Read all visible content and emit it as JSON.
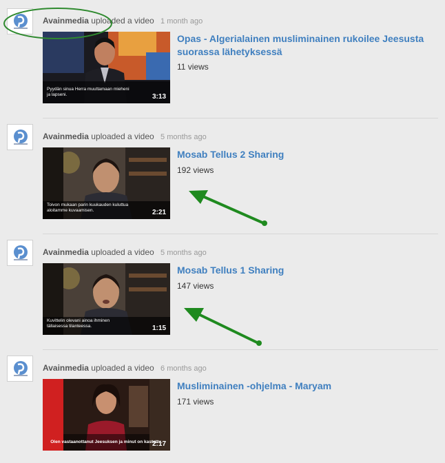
{
  "feed": {
    "items": [
      {
        "user": "Avainmedia",
        "action": "uploaded a video",
        "time": "1 month ago",
        "title": "Opas - Algerialainen musliminainen rukoilee Jeesusta suorassa lähetyksessä",
        "views": "11 views",
        "duration": "3:13",
        "subtitle": "Pyydän sinua Herra muuttamaan mieheni ja lapseni."
      },
      {
        "user": "Avainmedia",
        "action": "uploaded a video",
        "time": "5 months ago",
        "title": "Mosab Tellus 2 Sharing",
        "views": "192 views",
        "duration": "2:21",
        "subtitle": "Toivon mukaan parin kuukauden kuluttua aloitamme kuvaamisen."
      },
      {
        "user": "Avainmedia",
        "action": "uploaded a video",
        "time": "5 months ago",
        "title": "Mosab Tellus 1 Sharing",
        "views": "147 views",
        "duration": "1:15",
        "subtitle": "Kuvittelin olevani ainoa ihminen tällaisessa tilanteessa."
      },
      {
        "user": "Avainmedia",
        "action": "uploaded a video",
        "time": "6 months ago",
        "title": "Musliminainen -ohjelma - Maryam",
        "views": "171 views",
        "duration": "2:17",
        "subtitle": "Olen vastaanottanut Jeesuksen ja minut on kastettu."
      }
    ]
  },
  "annotations": {
    "highlight_color": "#2f8a2f",
    "arrow_color": "#1f8a1f"
  },
  "icons": {
    "avatar": "avainmedia-logo-icon"
  }
}
